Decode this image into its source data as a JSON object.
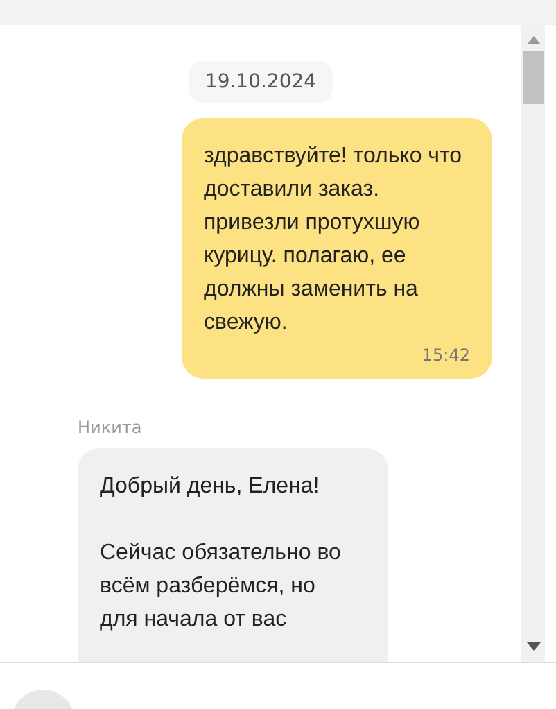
{
  "date_divider": "19.10.2024",
  "messages": [
    {
      "kind": "outgoing",
      "text": "здравствуйте! только что доставили заказ. привезли протухшую курицу. полагаю, ее должны заменить на свежую.",
      "time": "15:42"
    },
    {
      "kind": "incoming",
      "author": "Никита",
      "text": "Добрый день, Елена!\n\nСейчас обязательно во всём разберёмся, но для начала от вас"
    }
  ]
}
